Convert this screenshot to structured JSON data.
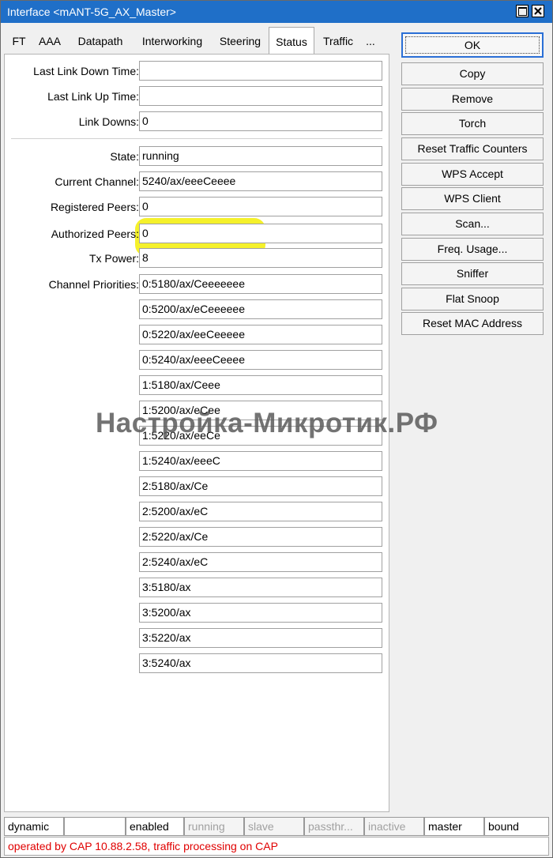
{
  "window": {
    "title": "Interface <mANT-5G_AX_Master>"
  },
  "tabs": [
    {
      "label": "FT"
    },
    {
      "label": "AAA"
    },
    {
      "label": "Datapath"
    },
    {
      "label": "Interworking"
    },
    {
      "label": "Steering"
    },
    {
      "label": "Status"
    },
    {
      "label": "Traffic"
    },
    {
      "label": "..."
    }
  ],
  "status": {
    "last_link_down_time": {
      "label": "Last Link Down Time:",
      "value": ""
    },
    "last_link_up_time": {
      "label": "Last Link Up Time:",
      "value": ""
    },
    "link_downs": {
      "label": "Link Downs:",
      "value": "0"
    },
    "state": {
      "label": "State:",
      "value": "running"
    },
    "current_channel": {
      "label": "Current Channel:",
      "value": "5240/ax/eeeCeeee"
    },
    "registered_peers": {
      "label": "Registered Peers:",
      "value": "0"
    },
    "authorized_peers": {
      "label": "Authorized Peers:",
      "value": "0"
    },
    "tx_power": {
      "label": "Tx Power:",
      "value": "8"
    },
    "channel_priorities": {
      "label": "Channel Priorities:",
      "values": [
        "0:5180/ax/Ceeeeeee",
        "0:5200/ax/eCeeeeee",
        "0:5220/ax/eeCeeeee",
        "0:5240/ax/eeeCeeee",
        "1:5180/ax/Ceee",
        "1:5200/ax/eCee",
        "1:5220/ax/eeCe",
        "1:5240/ax/eeeC",
        "2:5180/ax/Ce",
        "2:5200/ax/eC",
        "2:5220/ax/Ce",
        "2:5240/ax/eC",
        "3:5180/ax",
        "3:5200/ax",
        "3:5220/ax",
        "3:5240/ax"
      ]
    }
  },
  "watermark": "Настройка-Микротик.РФ",
  "buttons": {
    "ok": "OK",
    "copy": "Copy",
    "remove": "Remove",
    "torch": "Torch",
    "reset_traffic_counters": "Reset Traffic Counters",
    "wps_accept": "WPS Accept",
    "wps_client": "WPS Client",
    "scan": "Scan...",
    "freq_usage": "Freq. Usage...",
    "sniffer": "Sniffer",
    "flat_snoop": "Flat Snoop",
    "reset_mac_address": "Reset MAC Address"
  },
  "statusbar": [
    {
      "text": "dynamic",
      "active": true
    },
    {
      "text": "",
      "active": true
    },
    {
      "text": "enabled",
      "active": true
    },
    {
      "text": "running",
      "active": false
    },
    {
      "text": "slave",
      "active": false
    },
    {
      "text": "passthr...",
      "active": false
    },
    {
      "text": "inactive",
      "active": false
    },
    {
      "text": "master",
      "active": true
    },
    {
      "text": "bound",
      "active": true
    }
  ],
  "message": "operated by CAP 10.88.2.58, traffic processing on CAP",
  "colors": {
    "titlebar": "#1f6fc8",
    "highlight": "#f4f020",
    "message_text": "#e00000"
  }
}
